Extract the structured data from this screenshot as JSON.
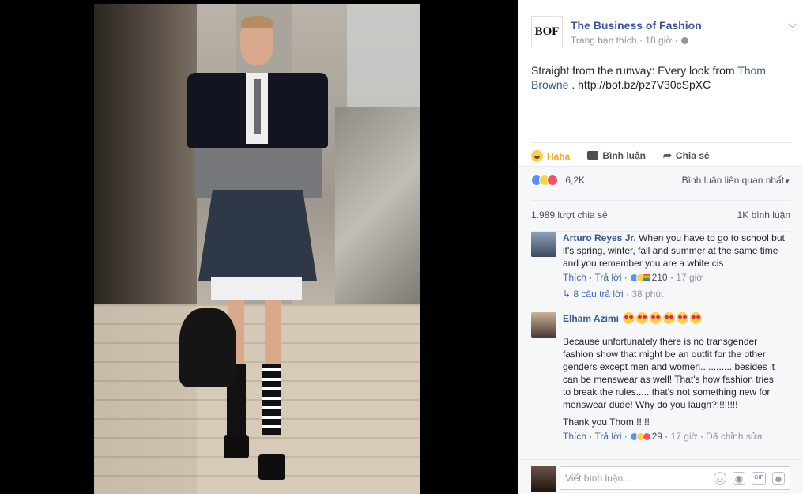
{
  "post": {
    "page_name": "The Business of Fashion",
    "logo_text": "BOF",
    "meta_text": "Trang bạn thích · 18 giờ ·",
    "text_before_link": "Straight from the runway: Every look from ",
    "link_name": "Thom Browne",
    "text_after_link": " . http://bof.bz/pz7V30cSpXC"
  },
  "actions": {
    "haha": "Haha",
    "comment": "Bình luận",
    "share": "Chia sẻ"
  },
  "reactions": {
    "count": "6,2K",
    "sort_label": "Bình luận liên quan nhất"
  },
  "stats": {
    "shares": "1.989 lượt chia sẻ",
    "comments": "1K bình luận"
  },
  "comments": [
    {
      "author": "Arturo Reyes Jr.",
      "text": "When you have to go to school but it's spring, winter, fall and summer at the same time and you remember you are a white cis",
      "like": "Thích",
      "reply": "Trả lời",
      "reaction_count": "210",
      "time": "17 giờ",
      "replies": "8 câu trả lời",
      "replies_time": "38 phút"
    },
    {
      "author": "Elham Azimi",
      "text": "Because unfortunately there is no transgender fashion show that might be an outfit for the other genders except men and women............ besides it can be menswear as well! That's how fashion tries to break the rules..... that's not something new for menswear dude! Why do you laugh?!!!!!!!!",
      "text2": "Thank you Thom !!!!!",
      "like": "Thích",
      "reply": "Trả lời",
      "reaction_count": "29",
      "time": "17 giờ",
      "edited": "Đã chỉnh sửa"
    }
  ],
  "composer": {
    "placeholder": "Viết bình luận..."
  },
  "colors": {
    "link": "#365899",
    "haha": "#f5a623"
  }
}
